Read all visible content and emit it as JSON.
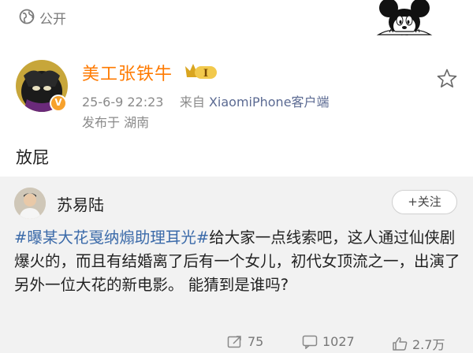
{
  "top": {
    "visibility": "公开"
  },
  "post": {
    "author": "美工张铁牛",
    "vip_level": "I",
    "verified_badge": "V",
    "time": "25-6-9 22:23",
    "source_prefix": "来自",
    "source": "XiaomiPhone客户端",
    "location": "发布于 湖南",
    "text": "放屁"
  },
  "repost": {
    "author": "苏易陆",
    "follow_label": "+关注",
    "hashtag": "#曝某大花戛纳煽助理耳光#",
    "body": "给大家一点线索吧，这人通过仙侠剧爆火的，而且有结婚离了后有一个女儿，初代女顶流之一，出演了另外一位大花的新电影。 能猜到是谁吗?",
    "repost_count": "75",
    "comment_count": "1027",
    "like_count": "2.7万"
  },
  "colors": {
    "author_orange": "#ff7a00",
    "hashtag_blue": "#3b6aa9",
    "repost_bg": "#f2f2f2"
  },
  "icons": [
    "globe-icon",
    "mickey-sticker",
    "vip-crown-badge",
    "star-icon",
    "verified-icon",
    "repost-icon",
    "comment-icon",
    "like-icon"
  ]
}
